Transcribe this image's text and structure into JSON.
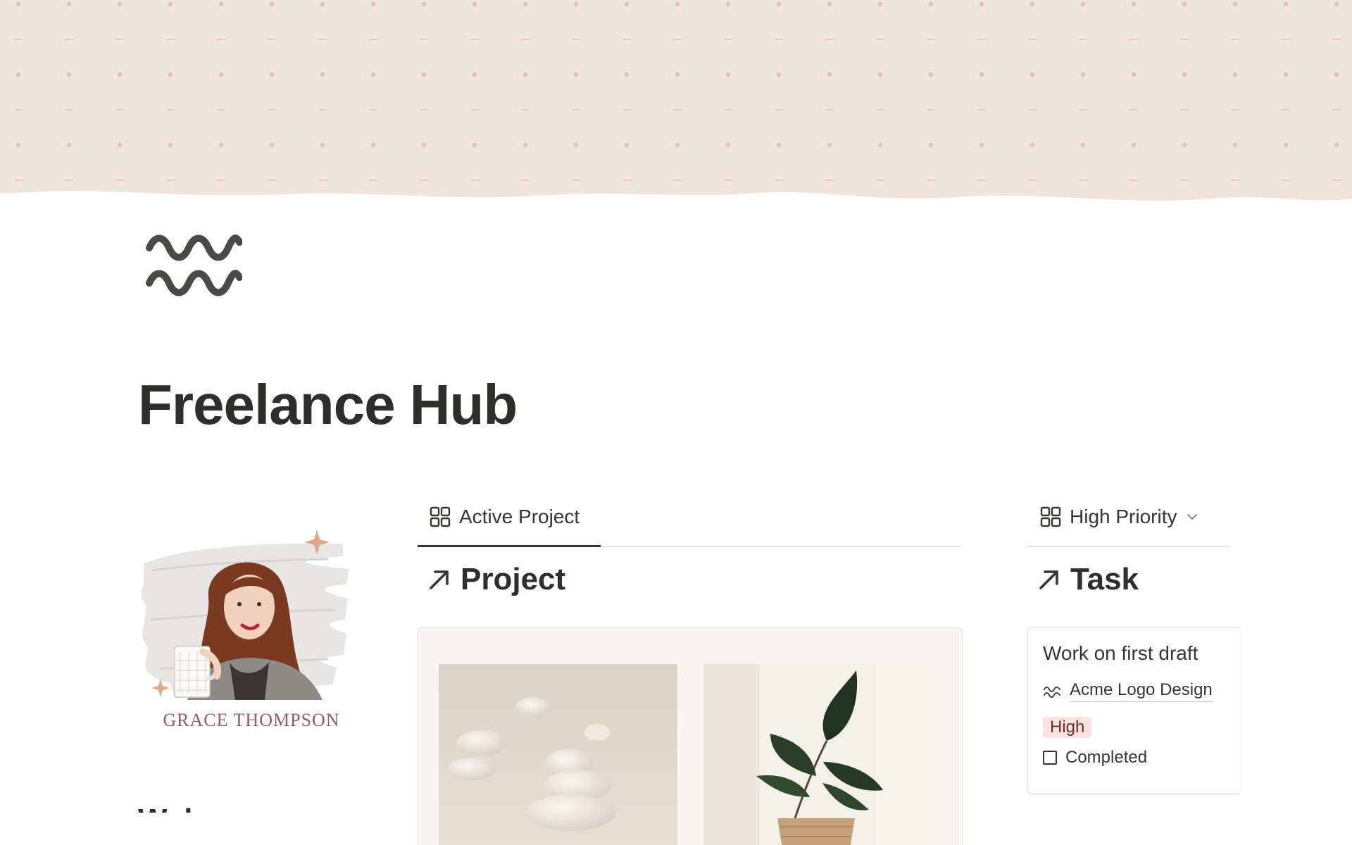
{
  "page": {
    "title": "Freelance Hub",
    "icon": "double-wave-icon"
  },
  "profile": {
    "name": "GRACE THOMPSON"
  },
  "welcome_peek": "Welcome",
  "tabs": {
    "project_tab": {
      "label": "Active Project",
      "icon": "gallery-grid-icon"
    },
    "task_tab": {
      "label": "High Priority",
      "icon": "gallery-grid-icon",
      "dropdown_icon": "chevron-down-icon"
    }
  },
  "project_section": {
    "heading": "Project",
    "icon": "arrow-up-right-icon"
  },
  "task_section": {
    "heading": "Task",
    "icon": "arrow-up-right-icon"
  },
  "task_card": {
    "title": "Work on first draft",
    "relation": "Acme Logo Design",
    "relation_icon": "double-wave-icon",
    "priority": "High",
    "status_label": "Completed",
    "completed": false
  },
  "colors": {
    "cover_bg": "#efe5de",
    "cover_dots": "#e4b7ad",
    "title": "#2f2e2a",
    "name": "#9a5a62",
    "priority_bg": "#fde2e0"
  }
}
